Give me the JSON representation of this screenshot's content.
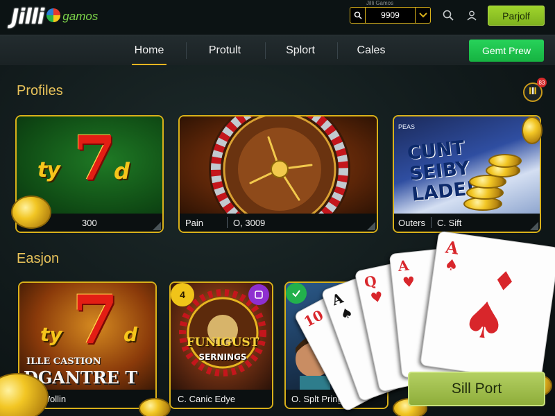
{
  "header": {
    "logo_main": "Jilli",
    "logo_sub": "gamos",
    "title_small": "Jilli Gamos",
    "search_value": "9909",
    "payout_label": "Parjolf"
  },
  "nav": {
    "items": [
      {
        "label": "Home",
        "active": true
      },
      {
        "label": "Protult",
        "active": false
      },
      {
        "label": "Splort",
        "active": false
      },
      {
        "label": "Cales",
        "active": false
      }
    ],
    "game_preview_label": "Gemt Prew"
  },
  "notification": {
    "badge": "83"
  },
  "sections": {
    "profiles_title": "Profiles",
    "easjon_title": "Easjon"
  },
  "profile_cards": [
    {
      "art_text": "ty7d",
      "foot": [
        "300"
      ]
    },
    {
      "art_text": "",
      "foot": [
        "Pain",
        "O, 3009"
      ]
    },
    {
      "art_text": "CUNT SEIBY LADE!",
      "corner_text": "PEAS",
      "foot": [
        "Outers",
        "C. Sift"
      ]
    }
  ],
  "easjon_cards": [
    {
      "art_text": "ty7d",
      "banner_top": "ILLE CASTION",
      "banner_bottom": "DGANTRE T",
      "foot": [
        "Wollin"
      ]
    },
    {
      "art_text": "FUNIGUST",
      "art_sub": "SERNINGS",
      "badge_left": "4",
      "foot": [
        "C. Canic Edye"
      ]
    },
    {
      "art_text": "",
      "foot": [
        "O. Splt Prings"
      ]
    }
  ],
  "playing_cards": [
    {
      "rank": "10",
      "suit": "♦",
      "color": "#d8262b"
    },
    {
      "rank": "A",
      "suit": "♠",
      "color": "#111111"
    },
    {
      "rank": "Q",
      "suit": "♥",
      "color": "#d8262b"
    },
    {
      "rank": "A",
      "suit": "♥",
      "color": "#d8262b"
    },
    {
      "rank": "A",
      "suit": "♠",
      "color": "#d8262b"
    }
  ],
  "split_button_label": "Sill Port",
  "colors": {
    "accent_gold": "#d9b11a",
    "accent_green": "#27d35a",
    "lime": "#9fd42c"
  }
}
